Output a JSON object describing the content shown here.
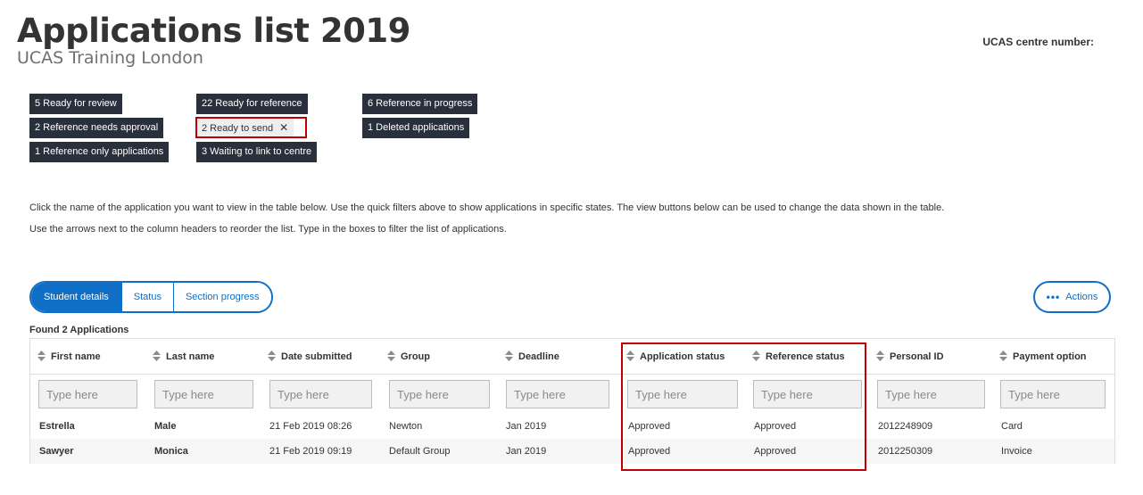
{
  "header": {
    "title": "Applications list 2019",
    "subtitle": "UCAS Training London",
    "centre_number_label": "UCAS centre number:"
  },
  "quick_filters": [
    {
      "label": "5 Ready for review",
      "active": false
    },
    {
      "label": "2 Reference needs approval",
      "active": false
    },
    {
      "label": "1 Reference only applications",
      "active": false
    },
    {
      "label": "22 Ready for reference",
      "active": false
    },
    {
      "label": "2 Ready to send",
      "active": true,
      "remove_glyph": "✕"
    },
    {
      "label": "3 Waiting to link to centre",
      "active": false
    },
    {
      "label": "6 Reference in progress",
      "active": false
    },
    {
      "label": "1 Deleted applications",
      "active": false
    }
  ],
  "instructions": [
    "Click the name of the application you want to view in the table below. Use the quick filters above to show applications in specific states. The view buttons below can be used to change the data shown in the table.",
    "Use the arrows next to the column headers to reorder the list. Type in the boxes to filter the list of applications."
  ],
  "views": {
    "tabs": [
      {
        "label": "Student details",
        "selected": true
      },
      {
        "label": "Status",
        "selected": false
      },
      {
        "label": "Section progress",
        "selected": false
      }
    ],
    "actions_label": "Actions",
    "actions_icon": "more-horizontal-icon"
  },
  "table": {
    "found_text": "Found 2 Applications",
    "filter_placeholder": "Type here",
    "columns": [
      "First name",
      "Last name",
      "Date submitted",
      "Group",
      "Deadline",
      "Application status",
      "Reference status",
      "Personal ID",
      "Payment option"
    ],
    "rows": [
      [
        "Estrella",
        "Male",
        "21 Feb 2019 08:26",
        "Newton",
        "Jan 2019",
        "Approved",
        "Approved",
        "2012248909",
        "Card"
      ],
      [
        "Sawyer",
        "Monica",
        "21 Feb 2019 09:19",
        "Default Group",
        "Jan 2019",
        "Approved",
        "Approved",
        "2012250309",
        "Invoice"
      ]
    ]
  },
  "colors": {
    "accent": "#0f6fc6",
    "filter_bg": "#2a2f3c",
    "highlight": "#c00000"
  }
}
